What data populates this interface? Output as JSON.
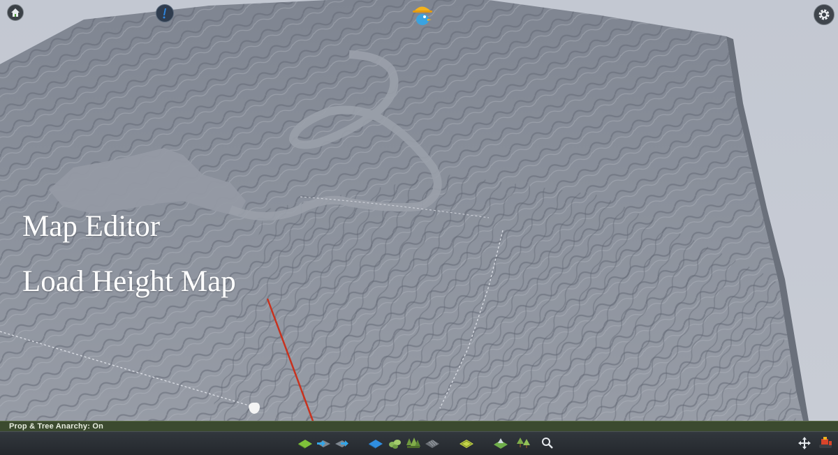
{
  "overlay": {
    "line1": "Map Editor",
    "line2": "Load Height Map"
  },
  "status_bar": {
    "text": "Prop & Tree Anarchy: On"
  },
  "toolbar": {
    "tools": [
      {
        "name": "terrain-tool-icon"
      },
      {
        "name": "import-heightmap-icon"
      },
      {
        "name": "export-heightmap-icon"
      },
      {
        "name": "water-icon"
      },
      {
        "name": "resources-icon"
      },
      {
        "name": "trees-icon"
      },
      {
        "name": "surface-icon"
      },
      {
        "name": "areas-icon"
      },
      {
        "name": "map-theme-icon"
      },
      {
        "name": "decorations-icon"
      },
      {
        "name": "search-icon"
      },
      {
        "name": "move-icon"
      },
      {
        "name": "bulldozer-icon"
      }
    ]
  },
  "colors": {
    "terrain": "#8d939e",
    "sky": "#c6cad3",
    "status_bar": "#3b4a2f",
    "toolbar": "#2b3035",
    "arrow": "#c8321e"
  }
}
